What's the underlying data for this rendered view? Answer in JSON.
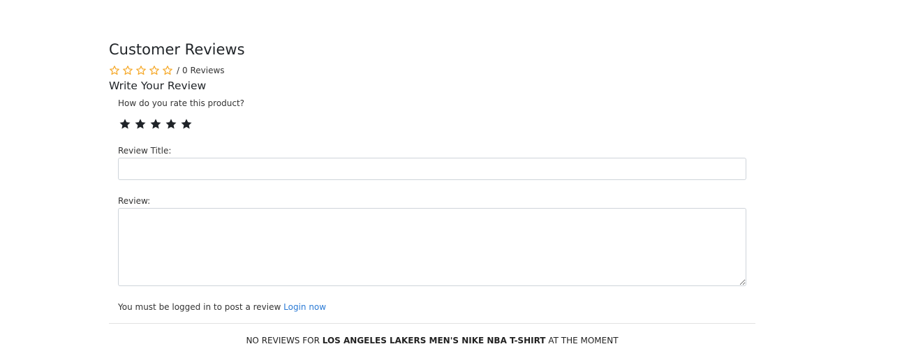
{
  "reviews_section": {
    "title": "Customer Reviews",
    "average_rating": 0,
    "max_rating": 5,
    "summary_separator": "/",
    "review_count_text": "0 Reviews",
    "empty_star_color": "#f5a623"
  },
  "write_review": {
    "title": "Write Your Review",
    "rate_question": "How do you rate this product?",
    "rate_star_color": "#1f2328",
    "rating_star_icons": [
      "star-icon",
      "star-icon",
      "star-icon",
      "star-icon",
      "star-icon"
    ],
    "review_title_label": "Review Title:",
    "review_title_value": "",
    "review_label": "Review:",
    "review_value": "",
    "login_prompt": "You must be logged in to post a review",
    "login_link": "Login now",
    "link_color": "#2a7ad5"
  },
  "no_reviews": {
    "prefix": "NO REVIEWS FOR",
    "product_name": "LOS ANGELES LAKERS MEN'S NIKE NBA T-SHIRT",
    "suffix": "AT THE MOMENT"
  }
}
